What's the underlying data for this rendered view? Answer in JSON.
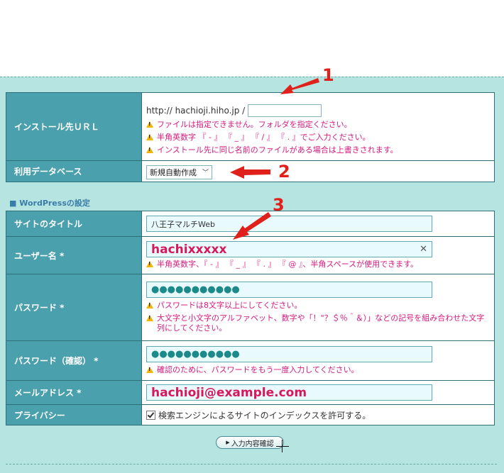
{
  "install": {
    "label": "インストール先ＵＲＬ",
    "url_prefix": "http:// hachioji.hiho.jp /",
    "input_value": "",
    "warnings": [
      "ファイルは指定できません。フォルダを指定ください。",
      "半角英数字 『 - 』 『 _ 』 『 / 』 『 . 』でご入力ください。",
      "インストール先に同じ名前のファイルがある場合は上書きされます。"
    ]
  },
  "database": {
    "label": "利用データベース",
    "selected": "新規自動作成"
  },
  "wordpress_section": {
    "title": "■ WordPressの設定"
  },
  "site_title": {
    "label": "サイトのタイトル",
    "value": "八王子マルチWeb"
  },
  "username": {
    "label": "ユーザー名 *",
    "value": "hachixxxxx",
    "warning": "半角英数字、『 - 』 『 _ 』 『 . 』 『 @ 』、半角スペースが使用できます。"
  },
  "password": {
    "label": "パスワード *",
    "masked": "●●●●●●●●●●●",
    "warnings": [
      "パスワードは8文字以上にしてください。",
      "大文字と小文字のアルファベット、数字や「！\"？＄％＾＆）」などの記号を組み合わせた文字列にしてください。"
    ]
  },
  "password_confirm": {
    "label": "パスワード（確認） *",
    "masked": "●●●●●●●●●●●",
    "warning": "確認のために、パスワードをもう一度入力してください。"
  },
  "email": {
    "label": "メールアドレス *",
    "value": "hachioji@example.com"
  },
  "privacy": {
    "label": "プライバシー",
    "checkbox_label": "検索エンジンによるサイトのインデックスを許可する。",
    "checked": true
  },
  "confirm_button": {
    "label": "入力内容確認"
  },
  "annotations": {
    "n1": "1",
    "n2": "2",
    "n3": "3",
    "color": "#e0201a"
  },
  "colors": {
    "label_bg": "#4ba0ad",
    "panel_bg": "#b6e4e1",
    "warning_text": "#d61a7f"
  }
}
